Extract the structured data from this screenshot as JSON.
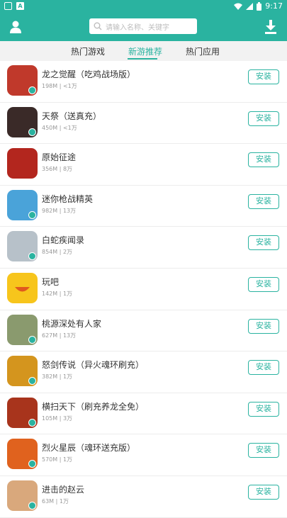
{
  "status_bar": {
    "time": "9:17"
  },
  "search": {
    "placeholder": "请输入名称、关键字"
  },
  "tabs": [
    {
      "label": "热门游戏"
    },
    {
      "label": "新游推荐"
    },
    {
      "label": "热门应用"
    }
  ],
  "colors": {
    "accent": "#2ab3a0"
  },
  "apps": [
    {
      "name": "龙之觉醒（吃鸡战场版）",
      "meta": "198M | <1万",
      "button": "安装",
      "icon_color": "#c0392b"
    },
    {
      "name": "天祭（送真充）",
      "meta": "450M | <1万",
      "button": "安装",
      "icon_color": "#3a2a28"
    },
    {
      "name": "原始征途",
      "meta": "356M | 8万",
      "button": "安装",
      "icon_color": "#b3261e"
    },
    {
      "name": "迷你枪战精英",
      "meta": "982M | 13万",
      "button": "安装",
      "icon_color": "#4aa3d9"
    },
    {
      "name": "白蛇疾闻录",
      "meta": "854M | 2万",
      "button": "安装",
      "icon_color": "#b7c1c9"
    },
    {
      "name": "玩吧",
      "meta": "142M | 1万",
      "button": "安装",
      "icon_color": "#f7c51c"
    },
    {
      "name": "桃源深处有人家",
      "meta": "627M | 13万",
      "button": "安装",
      "icon_color": "#8a9a6e"
    },
    {
      "name": "怒剑传说（异火魂环刷充）",
      "meta": "382M | 1万",
      "button": "安装",
      "icon_color": "#d4951e"
    },
    {
      "name": "横扫天下（刷充养龙全免）",
      "meta": "105M | 3万",
      "button": "安装",
      "icon_color": "#a8341c"
    },
    {
      "name": "烈火星辰（魂环送充版）",
      "meta": "570M | 1万",
      "button": "安装",
      "icon_color": "#e0621e"
    },
    {
      "name": "进击的赵云",
      "meta": "63M | 1万",
      "button": "安装",
      "icon_color": "#d9a87c"
    }
  ]
}
